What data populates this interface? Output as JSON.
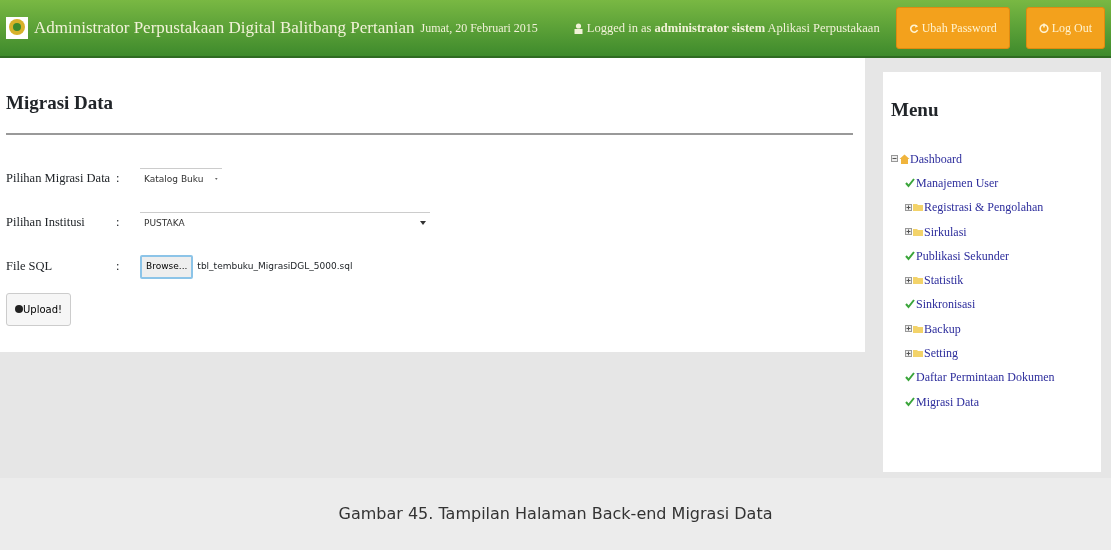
{
  "header": {
    "title": "Administrator Perpustakaan Digital Balitbang Pertanian",
    "date": "Jumat, 20 Februari 2015",
    "login_prefix": "Logged in as",
    "login_user": "administrator sistem Aplikasi Perpustakaan",
    "buttons": [
      {
        "label": "Ubah Password",
        "kind": "refresh"
      },
      {
        "label": "Log Out",
        "kind": "power"
      }
    ]
  },
  "main": {
    "title": "Migrasi Data",
    "fields": [
      {
        "label": "Pilihan Migrasi Data",
        "kind": "select",
        "value": "Katalog Buku",
        "wide": false
      },
      {
        "label": "Pilihan Institusi",
        "kind": "select",
        "value": "PUSTAKA",
        "wide": true
      },
      {
        "label": "File SQL",
        "kind": "file",
        "button": "Browse...",
        "value": "tbl_tembuku_MigrasiDGL_5000.sql"
      }
    ],
    "separator": ":",
    "upload_button": "Upload!"
  },
  "menu": {
    "title": "Menu",
    "tree": [
      {
        "label": "Dashboard",
        "kind": "home",
        "expanded": true,
        "children": [
          {
            "label": "Manajemen User",
            "kind": "leaf"
          },
          {
            "label": "Registrasi & Pengolahan",
            "kind": "folder",
            "expanded": false
          },
          {
            "label": "Sirkulasi",
            "kind": "folder",
            "expanded": false
          },
          {
            "label": "Publikasi Sekunder",
            "kind": "leaf"
          },
          {
            "label": "Statistik",
            "kind": "folder",
            "expanded": false
          },
          {
            "label": "Sinkronisasi",
            "kind": "leaf"
          },
          {
            "label": "Backup",
            "kind": "folder",
            "expanded": false
          },
          {
            "label": "Setting",
            "kind": "folder",
            "expanded": false
          },
          {
            "label": "Daftar Permintaan Dokumen",
            "kind": "leaf"
          },
          {
            "label": "Migrasi Data",
            "kind": "leaf"
          }
        ]
      }
    ]
  },
  "caption": "Gambar 45.  Tampilan Halaman Back-end Migrasi Data"
}
